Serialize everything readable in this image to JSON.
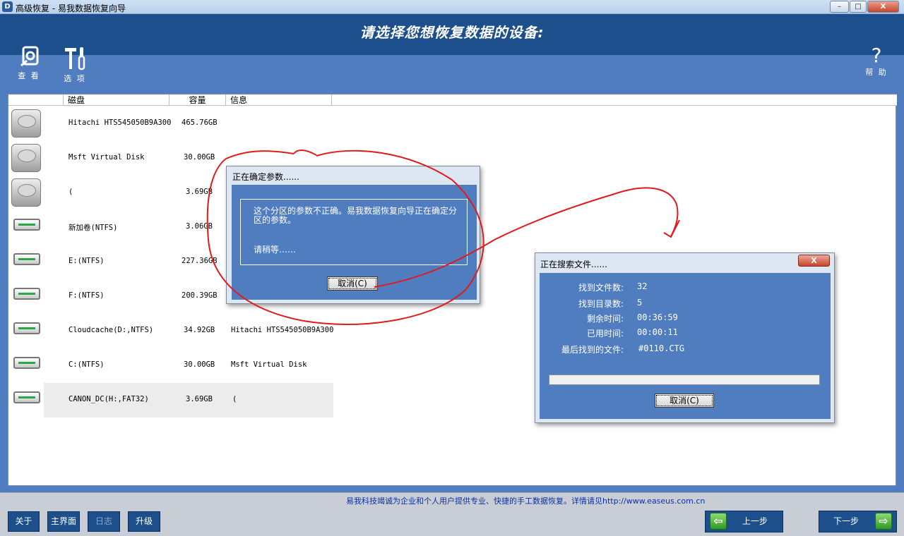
{
  "window": {
    "icon_text": "D",
    "title": "高级恢复 - 易我数据恢复向导",
    "controls": [
      "–",
      "□",
      "X"
    ]
  },
  "header": {
    "title": "请选择您想恢复数据的设备:"
  },
  "toolbar": {
    "view_label": "查 看",
    "options_label": "选 项",
    "help_label": "帮 助",
    "help_glyph": "?"
  },
  "table": {
    "columns": [
      "磁盘",
      "容量",
      "信息"
    ],
    "rows": [
      {
        "icon": "hard-disk-icon",
        "name": "Hitachi HTS545050B9A300",
        "capacity": "465.76GB",
        "info": ""
      },
      {
        "icon": "hard-disk-icon",
        "name": "Msft Virtual Disk",
        "capacity": "30.00GB",
        "info": ""
      },
      {
        "icon": "hard-disk-icon",
        "name": "(",
        "capacity": "3.69GB",
        "info": ""
      },
      {
        "icon": "partition-icon",
        "name": "新加卷(NTFS)",
        "capacity": "3.06GB",
        "info": ""
      },
      {
        "icon": "partition-icon",
        "name": "E:(NTFS)",
        "capacity": "227.36GB",
        "info": ""
      },
      {
        "icon": "partition-icon",
        "name": "F:(NTFS)",
        "capacity": "200.39GB",
        "info": ""
      },
      {
        "icon": "partition-icon",
        "name": "Cloudcache(D:,NTFS)",
        "capacity": "34.92GB",
        "info": "Hitachi HTS545050B9A300"
      },
      {
        "icon": "partition-icon",
        "name": "C:(NTFS)",
        "capacity": "30.00GB",
        "info": "Msft Virtual Disk"
      },
      {
        "icon": "partition-icon",
        "name": "CANON_DC(H:,FAT32)",
        "capacity": "3.69GB",
        "info": "(",
        "selected": true
      }
    ]
  },
  "dialog_params": {
    "title": "正在确定参数......",
    "message": "这个分区的参数不正确。易我数据恢复向导正在确定分区的参数。",
    "wait": "请稍等……",
    "cancel_label": "取消(C)"
  },
  "dialog_search": {
    "title": "正在搜索文件......",
    "close_glyph": "X",
    "fields": [
      {
        "label": "找到文件数:",
        "value": "32"
      },
      {
        "label": "找到目录数:",
        "value": "5"
      },
      {
        "label": "剩余时间:",
        "value": "00:36:59"
      },
      {
        "label": "已用时间:",
        "value": "00:00:11"
      },
      {
        "label": "最后找到的文件:",
        "value": "#0110.CTG"
      }
    ],
    "progress": 0,
    "cancel_label": "取消(C)"
  },
  "footer": {
    "note": "易我科技竭诚为企业和个人用户提供专业、快捷的手工数据恢复。详情请见http://www.easeus.com.cn",
    "buttons": [
      {
        "label": "关于",
        "enabled": true
      },
      {
        "label": "主界面",
        "enabled": true
      },
      {
        "label": "日志",
        "enabled": false
      },
      {
        "label": "升级",
        "enabled": true
      }
    ],
    "prev_label": "上一步",
    "next_label": "下一步",
    "prev_arrow": "⇦",
    "next_arrow": "⇨"
  },
  "annotation_color": "#e11b1b"
}
